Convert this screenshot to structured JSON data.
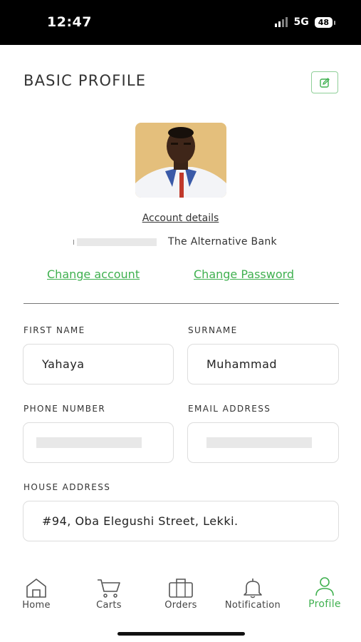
{
  "status_bar": {
    "time": "12:47",
    "network": "5G",
    "battery": "48"
  },
  "header": {
    "title": "BASIC PROFILE"
  },
  "account": {
    "details_label": "Account details",
    "bank_name": "The Alternative Bank",
    "change_account_label": "Change account",
    "change_password_label": "Change Password"
  },
  "form": {
    "first_name_label": "FIRST NAME",
    "first_name_value": "Yahaya",
    "surname_label": "SURNAME",
    "surname_value": "Muhammad",
    "phone_label": "PHONE NUMBER",
    "email_label": "EMAIL ADDRESS",
    "address_label": "HOUSE ADDRESS",
    "address_value": "#94, Oba Elegushi Street, Lekki."
  },
  "tabs": [
    {
      "label": "Home",
      "icon": "home-icon"
    },
    {
      "label": "Carts",
      "icon": "cart-icon"
    },
    {
      "label": "Orders",
      "icon": "orders-icon"
    },
    {
      "label": "Notification",
      "icon": "bell-icon"
    },
    {
      "label": "Profile",
      "icon": "user-icon",
      "active": true
    }
  ],
  "colors": {
    "accent": "#3fb04f"
  }
}
